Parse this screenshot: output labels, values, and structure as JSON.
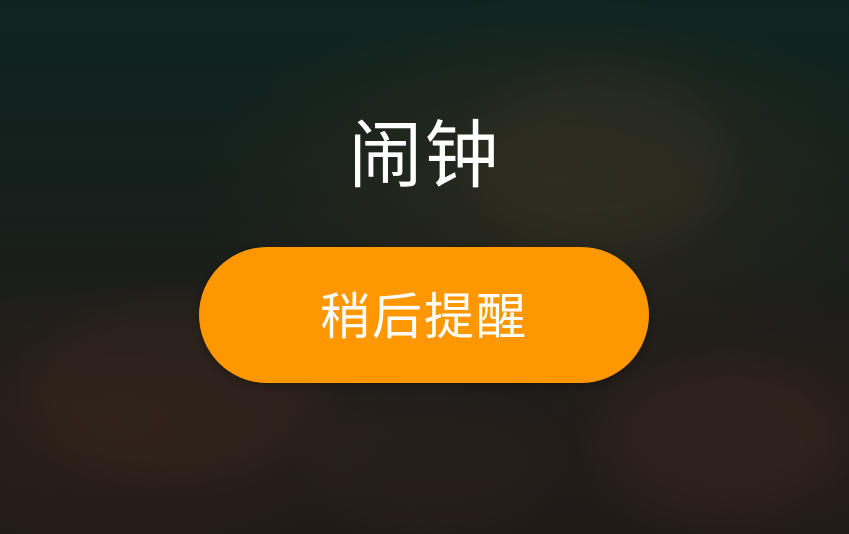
{
  "alarm": {
    "title": "闹钟",
    "snooze_label": "稍后提醒"
  },
  "colors": {
    "button_bg": "#ff9800",
    "text": "#ffffff"
  }
}
